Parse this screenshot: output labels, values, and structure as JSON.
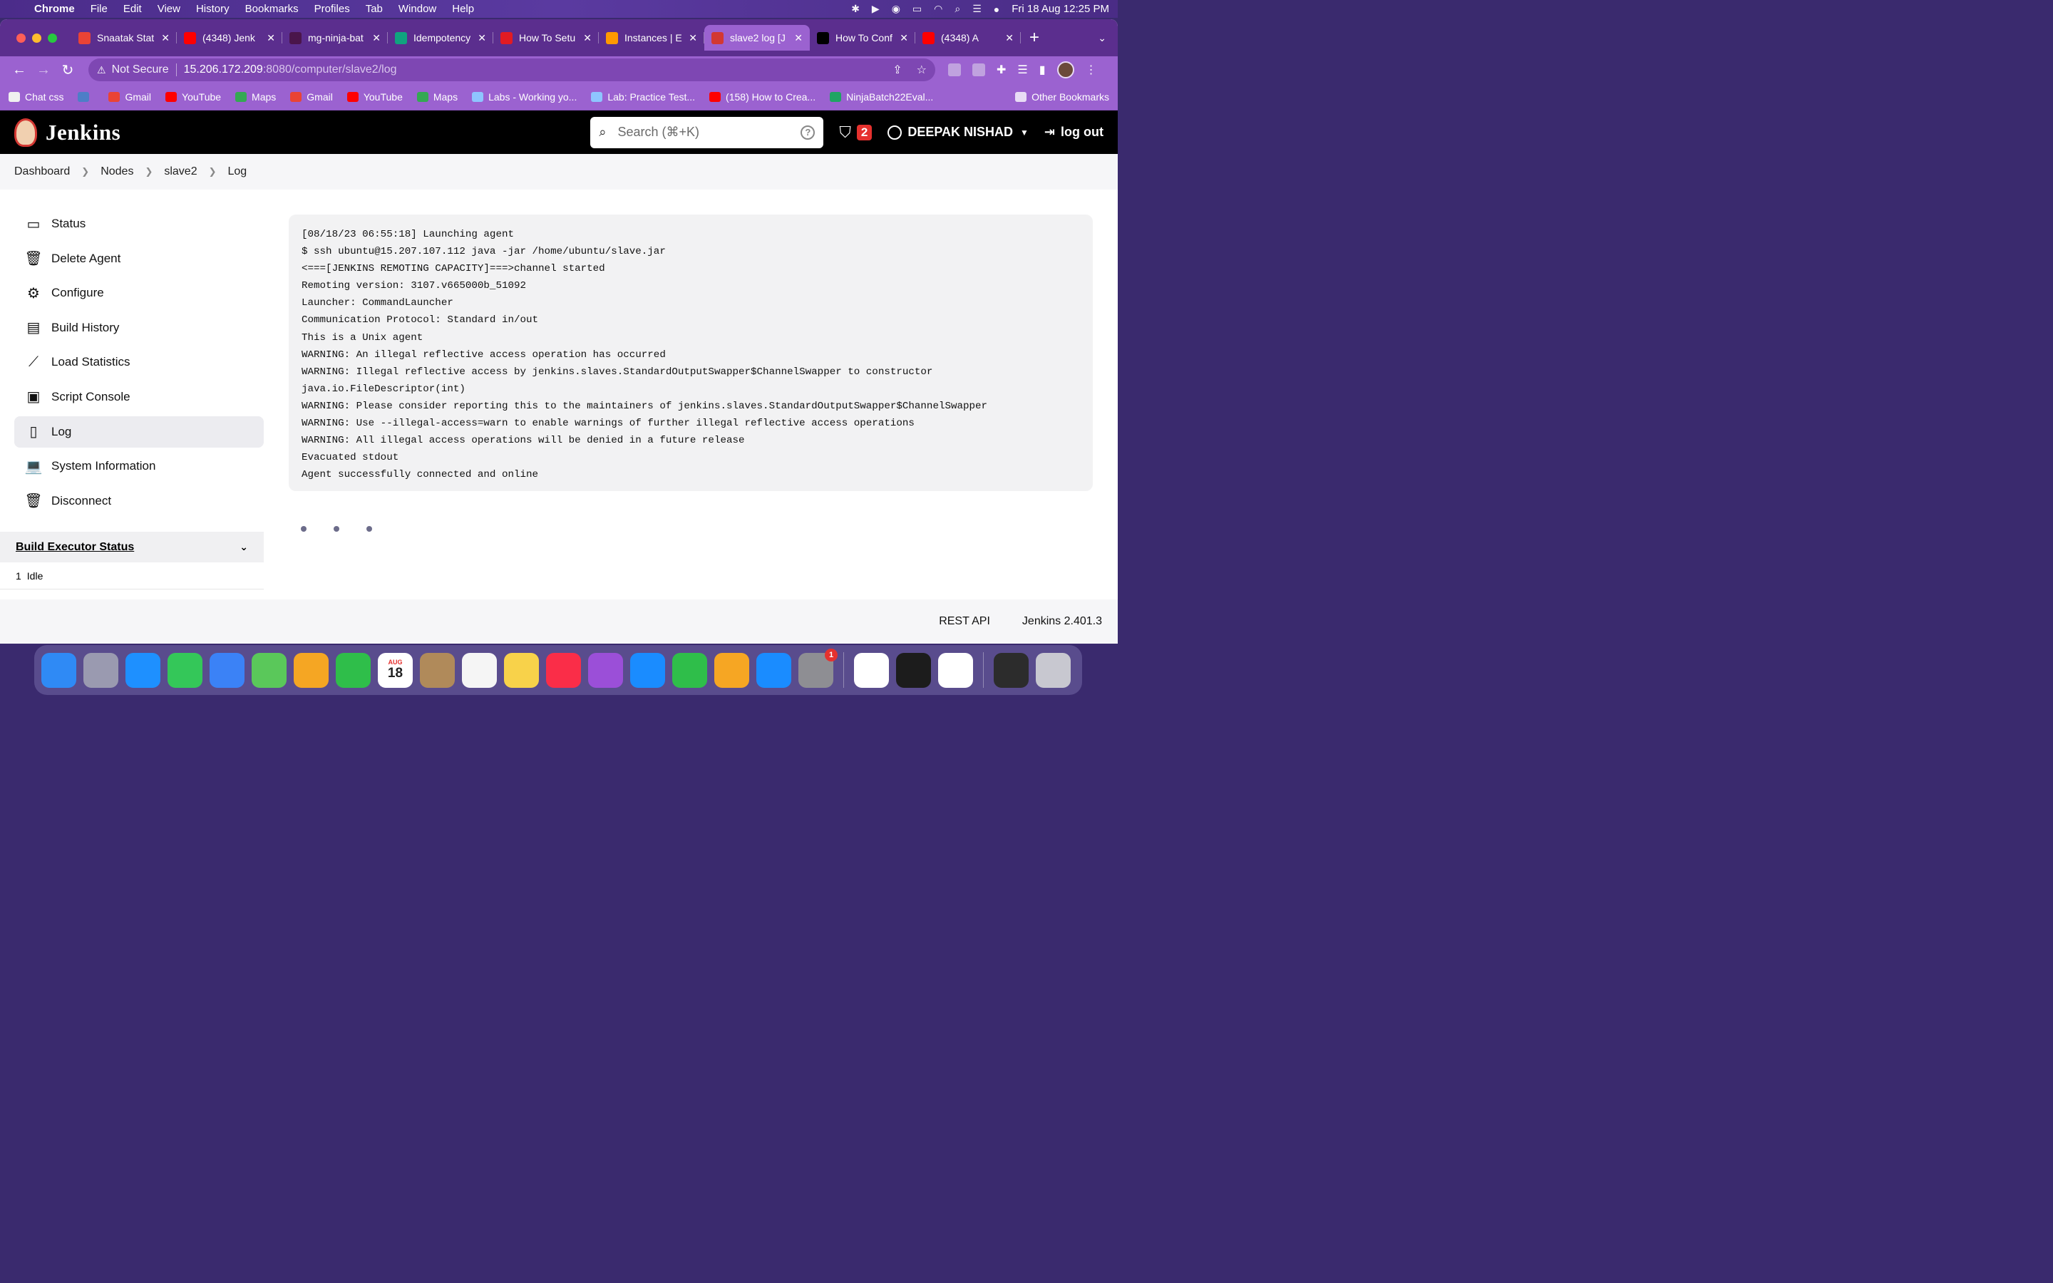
{
  "menubar": {
    "app": "Chrome",
    "items": [
      "File",
      "Edit",
      "View",
      "History",
      "Bookmarks",
      "Profiles",
      "Tab",
      "Window",
      "Help"
    ],
    "datetime": "Fri 18 Aug  12:25 PM"
  },
  "tabs": [
    {
      "title": "Snaatak Stat",
      "icon": "gmail-icon",
      "color": "#ea4335",
      "active": false
    },
    {
      "title": "(4348) Jenk",
      "icon": "youtube-icon",
      "color": "#ff0000",
      "active": false
    },
    {
      "title": "mg-ninja-bat",
      "icon": "slack-icon",
      "color": "#4a154b",
      "active": false
    },
    {
      "title": "Idempotency",
      "icon": "chatgpt-icon",
      "color": "#10a37f",
      "active": false
    },
    {
      "title": "How To Setu",
      "icon": "ansible-icon",
      "color": "#e21b23",
      "active": false
    },
    {
      "title": "Instances | E",
      "icon": "aws-icon",
      "color": "#ff9900",
      "active": false
    },
    {
      "title": "slave2 log [J",
      "icon": "jenkins-icon",
      "color": "#d33833",
      "active": true
    },
    {
      "title": "How To Conf",
      "icon": "medium-icon",
      "color": "#000000",
      "active": false
    },
    {
      "title": "(4348) A",
      "icon": "youtube-icon",
      "color": "#ff0000",
      "active": false
    }
  ],
  "address": {
    "security": "Not Secure",
    "host": "15.206.172.209",
    "path": ":8080/computer/slave2/log"
  },
  "bookmarks": [
    {
      "label": "Chat css",
      "color": "#f0f0f0"
    },
    {
      "label": "",
      "color": "#4d7ec7"
    },
    {
      "label": "Gmail",
      "color": "#ea4335"
    },
    {
      "label": "YouTube",
      "color": "#ff0000"
    },
    {
      "label": "Maps",
      "color": "#34a853"
    },
    {
      "label": "Gmail",
      "color": "#ea4335"
    },
    {
      "label": "YouTube",
      "color": "#ff0000"
    },
    {
      "label": "Maps",
      "color": "#34a853"
    },
    {
      "label": "Labs - Working yo...",
      "color": "#8ec5ff"
    },
    {
      "label": "Lab: Practice Test...",
      "color": "#8ec5ff"
    },
    {
      "label": "(158) How to Crea...",
      "color": "#ff0000"
    },
    {
      "label": "NinjaBatch22Eval...",
      "color": "#1fa463"
    }
  ],
  "other_bookmarks": "Other Bookmarks",
  "jenkins": {
    "logo": "Jenkins",
    "search_placeholder": "Search (⌘+K)",
    "security_count": "2",
    "user": "DEEPAK NISHAD",
    "logout": "log out"
  },
  "breadcrumb": [
    "Dashboard",
    "Nodes",
    "slave2",
    "Log"
  ],
  "sidebar": [
    {
      "label": "Status",
      "icon": "monitor-icon",
      "active": false
    },
    {
      "label": "Delete Agent",
      "icon": "trash-icon",
      "active": false
    },
    {
      "label": "Configure",
      "icon": "gear-icon",
      "active": false
    },
    {
      "label": "Build History",
      "icon": "inbox-icon",
      "active": false
    },
    {
      "label": "Load Statistics",
      "icon": "trend-icon",
      "active": false
    },
    {
      "label": "Script Console",
      "icon": "terminal-icon",
      "active": false
    },
    {
      "label": "Log",
      "icon": "clipboard-icon",
      "active": true
    },
    {
      "label": "System Information",
      "icon": "computer-icon",
      "active": false
    },
    {
      "label": "Disconnect",
      "icon": "trash-icon",
      "active": false
    }
  ],
  "executor": {
    "title": "Build Executor Status",
    "rows": [
      {
        "num": "1",
        "status": "Idle"
      }
    ]
  },
  "log_lines": [
    "[08/18/23 06:55:18] Launching agent",
    "$ ssh ubuntu@15.207.107.112 java -jar /home/ubuntu/slave.jar",
    "<===[JENKINS REMOTING CAPACITY]===>channel started",
    "Remoting version: 3107.v665000b_51092",
    "Launcher: CommandLauncher",
    "Communication Protocol: Standard in/out",
    "This is a Unix agent",
    "WARNING: An illegal reflective access operation has occurred",
    "WARNING: Illegal reflective access by jenkins.slaves.StandardOutputSwapper$ChannelSwapper to constructor",
    "java.io.FileDescriptor(int)",
    "WARNING: Please consider reporting this to the maintainers of jenkins.slaves.StandardOutputSwapper$ChannelSwapper",
    "WARNING: Use --illegal-access=warn to enable warnings of further illegal reflective access operations",
    "WARNING: All illegal access operations will be denied in a future release",
    "Evacuated stdout",
    "Agent successfully connected and online"
  ],
  "footer": {
    "rest_api": "REST API",
    "version": "Jenkins 2.401.3"
  },
  "dock": [
    {
      "name": "finder-icon",
      "color": "#2f8af5"
    },
    {
      "name": "launchpad-icon",
      "color": "#9a9ab0"
    },
    {
      "name": "safari-icon",
      "color": "#1e90ff"
    },
    {
      "name": "messages-icon",
      "color": "#34c759"
    },
    {
      "name": "mail-icon",
      "color": "#3b82f6"
    },
    {
      "name": "maps-icon",
      "color": "#5ac85a"
    },
    {
      "name": "photos-icon",
      "color": "#f5a623"
    },
    {
      "name": "facetime-icon",
      "color": "#2fbe4a"
    },
    {
      "name": "calendar-icon",
      "color": "#ffffff",
      "text": "18",
      "sub": "AUG"
    },
    {
      "name": "contacts-icon",
      "color": "#b08a5a"
    },
    {
      "name": "reminders-icon",
      "color": "#f5f5f5"
    },
    {
      "name": "notes-icon",
      "color": "#f8d24a"
    },
    {
      "name": "music-icon",
      "color": "#fa2d48"
    },
    {
      "name": "podcasts-icon",
      "color": "#9b4fd8"
    },
    {
      "name": "keynote-icon",
      "color": "#1a8cff"
    },
    {
      "name": "numbers-icon",
      "color": "#2fbe4a"
    },
    {
      "name": "pages-icon",
      "color": "#f6a623"
    },
    {
      "name": "appstore-icon",
      "color": "#1a8cff"
    },
    {
      "name": "settings-icon",
      "color": "#8e8e93",
      "badge": "1"
    },
    {
      "name": "chrome-icon",
      "color": "#ffffff"
    },
    {
      "name": "terminal-icon",
      "color": "#1c1c1c"
    },
    {
      "name": "vscode-icon",
      "color": "#ffffff"
    },
    {
      "name": "screen-icon",
      "color": "#2c2c2c"
    },
    {
      "name": "trash-icon",
      "color": "#c8c8d0"
    }
  ]
}
